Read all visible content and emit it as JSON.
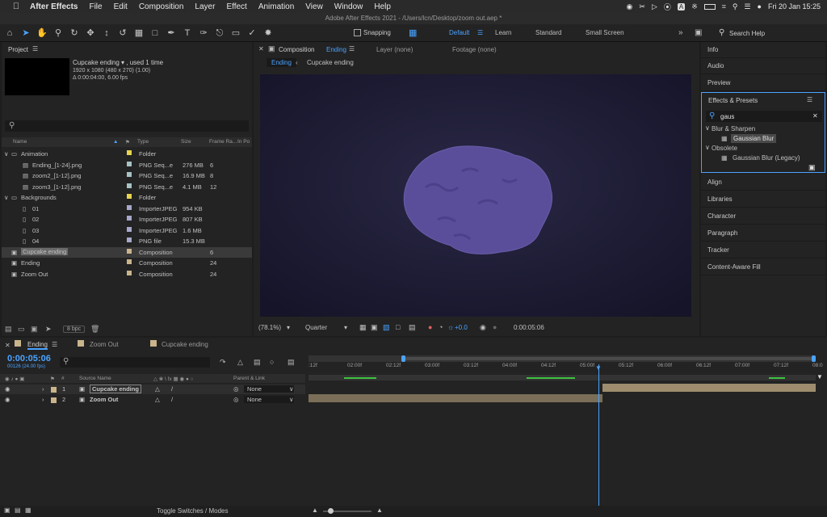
{
  "menubar": {
    "app": "After Effects",
    "items": [
      "File",
      "Edit",
      "Composition",
      "Layer",
      "Effect",
      "Animation",
      "View",
      "Window",
      "Help"
    ],
    "clock": "Fri 20 Jan  15:25"
  },
  "window_title": "Adobe After Effects 2021 - /Users/lcn/Desktop/zoom out.aep *",
  "toolbar": {
    "snapping": "Snapping",
    "workspaces": [
      "Default",
      "Learn",
      "Standard",
      "Small Screen"
    ],
    "search_help": "Search Help"
  },
  "project": {
    "title": "Project",
    "selected_name": "Cupcake ending ▾ , used 1 time",
    "selected_info1": "1920 x 1080  (480 x 270) (1.00)",
    "selected_info2": "Δ 0:00:04:00, 6.00 fps",
    "search_placeholder": "⌕",
    "columns": [
      "Name",
      "Type",
      "Size",
      "Frame Ra...",
      "In Po"
    ],
    "rows": [
      {
        "name": "Animation",
        "type": "Folder",
        "size": "",
        "fr": "",
        "indent": 0,
        "label": "#e8d44d",
        "kind": "folder",
        "sel": false
      },
      {
        "name": "Ending_[1-24].png",
        "type": "PNG Seq...e",
        "size": "276 MB",
        "fr": "6",
        "indent": 1,
        "label": "#a7c4c4",
        "kind": "seq",
        "sel": false
      },
      {
        "name": "zoom2_[1-12].png",
        "type": "PNG Seq...e",
        "size": "16.9 MB",
        "fr": "8",
        "indent": 1,
        "label": "#a7c4c4",
        "kind": "seq",
        "sel": false
      },
      {
        "name": "zoom3_[1-12].png",
        "type": "PNG Seq...e",
        "size": "4.1 MB",
        "fr": "12",
        "indent": 1,
        "label": "#a7c4c4",
        "kind": "seq",
        "sel": false
      },
      {
        "name": "Backgrounds",
        "type": "Folder",
        "size": "",
        "fr": "",
        "indent": 0,
        "label": "#e8d44d",
        "kind": "folder",
        "sel": false
      },
      {
        "name": "01",
        "type": "ImporterJPEG",
        "size": "954 KB",
        "fr": "",
        "indent": 1,
        "label": "#a8a8cc",
        "kind": "file",
        "sel": false
      },
      {
        "name": "02",
        "type": "ImporterJPEG",
        "size": "807 KB",
        "fr": "",
        "indent": 1,
        "label": "#a8a8cc",
        "kind": "file",
        "sel": false
      },
      {
        "name": "03",
        "type": "ImporterJPEG",
        "size": "1.6 MB",
        "fr": "",
        "indent": 1,
        "label": "#a8a8cc",
        "kind": "file",
        "sel": false
      },
      {
        "name": "04",
        "type": "PNG file",
        "size": "15.3 MB",
        "fr": "",
        "indent": 1,
        "label": "#a8a8cc",
        "kind": "file",
        "sel": false
      },
      {
        "name": "Cupcake ending",
        "type": "Composition",
        "size": "",
        "fr": "6",
        "indent": 0,
        "label": "#c9b48c",
        "kind": "comp",
        "sel": true
      },
      {
        "name": "Ending",
        "type": "Composition",
        "size": "",
        "fr": "24",
        "indent": 0,
        "label": "#c9b48c",
        "kind": "comp",
        "sel": false
      },
      {
        "name": "Zoom Out",
        "type": "Composition",
        "size": "",
        "fr": "24",
        "indent": 0,
        "label": "#c9b48c",
        "kind": "comp",
        "sel": false
      }
    ],
    "bpc": "8 bpc"
  },
  "comp": {
    "tab_label": "Composition",
    "tab_name": "Ending",
    "layer_tab": "Layer (none)",
    "footage_tab": "Footage (none)",
    "breadcrumb": [
      "Ending",
      "Cupcake ending"
    ],
    "zoom": "(78.1%)",
    "resolution": "Quarter",
    "exposure": "+0.0",
    "timecode": "0:00:05:06"
  },
  "right_panels": {
    "info": "Info",
    "audio": "Audio",
    "preview": "Preview",
    "effects_presets": "Effects & Presets",
    "search_value": "gaus",
    "blur_sharpen": "Blur & Sharpen",
    "gaussian_blur": "Gaussian Blur",
    "obsolete": "Obsolete",
    "gaussian_blur_legacy": "Gaussian Blur (Legacy)",
    "others": [
      "Align",
      "Libraries",
      "Character",
      "Paragraph",
      "Tracker",
      "Content-Aware Fill"
    ]
  },
  "timeline": {
    "tabs": [
      "Ending",
      "Zoom Out",
      "Cupcake ending"
    ],
    "timecode": "0:00:05:06",
    "frame_info": "00126 (24.00 fps)",
    "col_source": "Source Name",
    "col_parent": "Parent & Link",
    "layers": [
      {
        "num": "1",
        "name": "Cupcake ending",
        "parent": "None"
      },
      {
        "num": "2",
        "name": "Zoom Out",
        "parent": "None"
      }
    ],
    "ticks": [
      ":12f",
      "02:00f",
      "02:12f",
      "03:00f",
      "03:12f",
      "04:00f",
      "04:12f",
      "05:00f",
      "05:12f",
      "06:00f",
      "06:12f",
      "07:00f",
      "07:12f",
      "08:0"
    ],
    "toggle_label": "Toggle Switches / Modes"
  },
  "colors": {
    "accent": "#4aa3ff",
    "comp_bg": "#1c1b36",
    "blob": "#5a4e9a"
  }
}
